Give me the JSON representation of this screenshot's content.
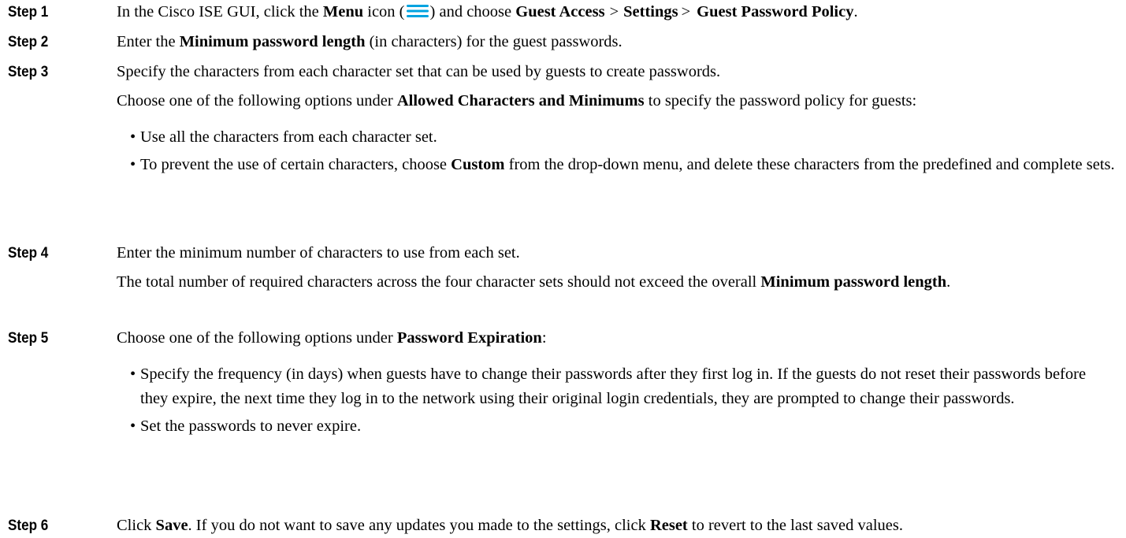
{
  "accent_color": "#00a3e0",
  "steps": [
    {
      "label": "Step 1",
      "p1": {
        "t1": "In the Cisco ISE GUI, click the ",
        "b1": "Menu",
        "t2": " icon (",
        "icon": "menu-icon",
        "t3": ") and choose ",
        "b2": "Guest Access",
        "sep1": ">",
        "b3": "Settings",
        "sep2": ">",
        "b4": "Guest Password Policy",
        "t4": "."
      }
    },
    {
      "label": "Step 2",
      "p1": {
        "t1": "Enter the ",
        "b1": "Minimum password length",
        "t2": " (in characters) for the guest passwords."
      }
    },
    {
      "label": "Step 3",
      "p1": "Specify the characters from each character set that can be used by guests to create passwords.",
      "p2": {
        "t1": "Choose one of the following options under ",
        "b1": "Allowed Characters and Minimums",
        "t2": " to specify the password policy for guests:"
      },
      "bullets": {
        "b1": "Use all the characters from each character set.",
        "b2": {
          "t1": "To prevent the use of certain characters, choose ",
          "bold": "Custom",
          "t2": " from the drop-down menu, and delete these characters from the predefined and complete sets."
        }
      }
    },
    {
      "label": "Step 4",
      "p1": "Enter the minimum number of characters to use from each set.",
      "p2": {
        "t1": "The total number of required characters across the four character sets should not exceed the overall ",
        "b1": "Minimum password length",
        "t2": "."
      }
    },
    {
      "label": "Step 5",
      "p1": {
        "t1": "Choose one of the following options under ",
        "b1": "Password Expiration",
        "t2": ":"
      },
      "bullets": {
        "b1": "Specify the frequency (in days) when guests have to change their passwords after they first log in. If the guests do not reset their passwords before they expire, the next time they log in to the network using their original login credentials, they are prompted to change their passwords.",
        "b2": "Set the passwords to never expire."
      }
    },
    {
      "label": "Step 6",
      "p1": {
        "t1": "Click ",
        "b1": "Save",
        "t2": ". If you do not want to save any updates you made to the settings, click ",
        "b2": "Reset",
        "t3": " to revert to the last saved values."
      }
    }
  ],
  "bullet_glyph": "•"
}
